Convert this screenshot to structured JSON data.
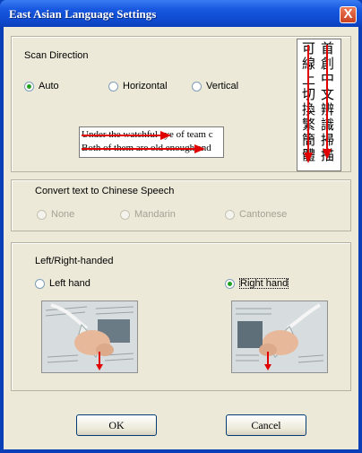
{
  "window": {
    "title": "East Asian Language Settings",
    "close_glyph": "X"
  },
  "scan": {
    "title": "Scan Direction",
    "options": [
      "Auto",
      "Horizontal",
      "Vertical"
    ],
    "selected": "Auto",
    "sample_en": [
      "Under the watchful eye of team c",
      "Both of them are old enough and"
    ],
    "sample_cjk_columns": [
      "首創中文辨識掃描",
      "可線上切換繁簡體"
    ]
  },
  "speech": {
    "title": "Convert text to Chinese Speech",
    "options": [
      "None",
      "Mandarin",
      "Cantonese"
    ]
  },
  "hand": {
    "title": "Left/Right-handed",
    "options": [
      "Left hand",
      "Right hand"
    ],
    "selected": "Right hand"
  },
  "buttons": {
    "ok": "OK",
    "cancel": "Cancel"
  },
  "colors": {
    "arrow": "#e00000",
    "selected_radio": "#21a121",
    "titlebar": "#0f4dd3"
  }
}
